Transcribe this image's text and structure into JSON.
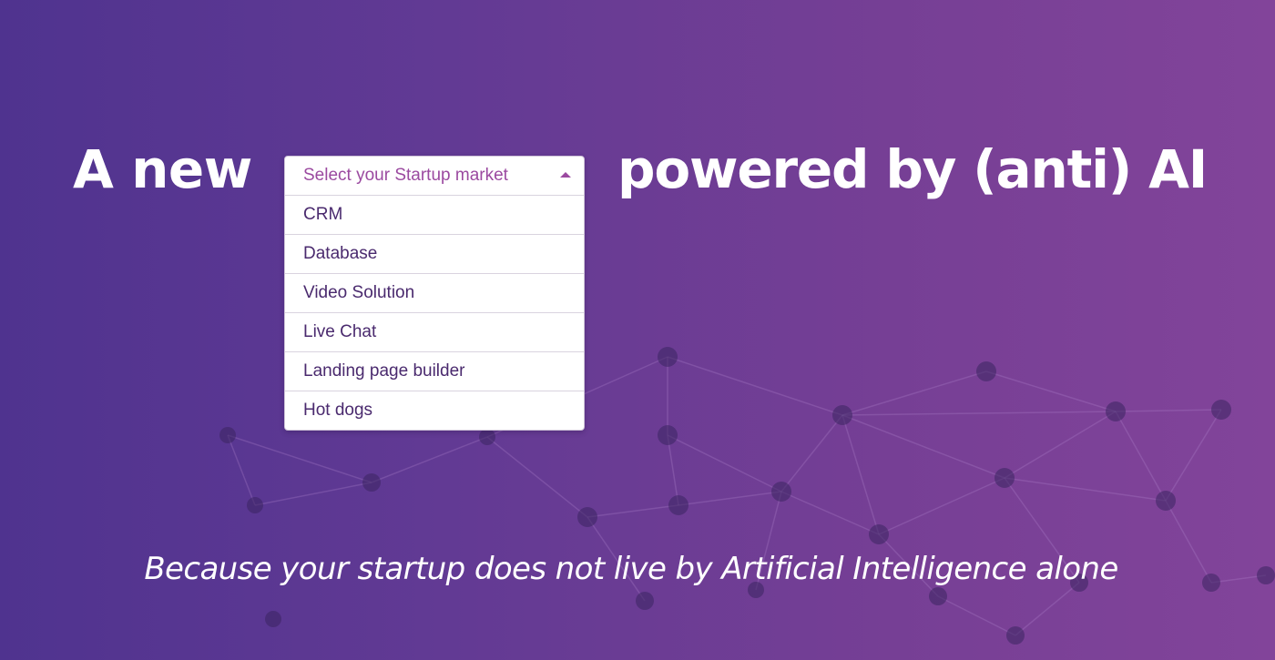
{
  "hero": {
    "headline_left": "A new",
    "headline_right": "powered by (anti) AI",
    "tagline": "Because your startup does not live by Artificial Intelligence alone"
  },
  "dropdown": {
    "placeholder": "Select your Startup market",
    "toggle_icon": "caret-up-icon",
    "options": [
      "CRM",
      "Database",
      "Video Solution",
      "Live Chat",
      "Landing page builder",
      "Hot dogs"
    ]
  },
  "colors": {
    "background_start": "#4f338f",
    "background_end": "#82449a",
    "accent": "#9b4aa0",
    "option_text": "#4a2a6e"
  }
}
